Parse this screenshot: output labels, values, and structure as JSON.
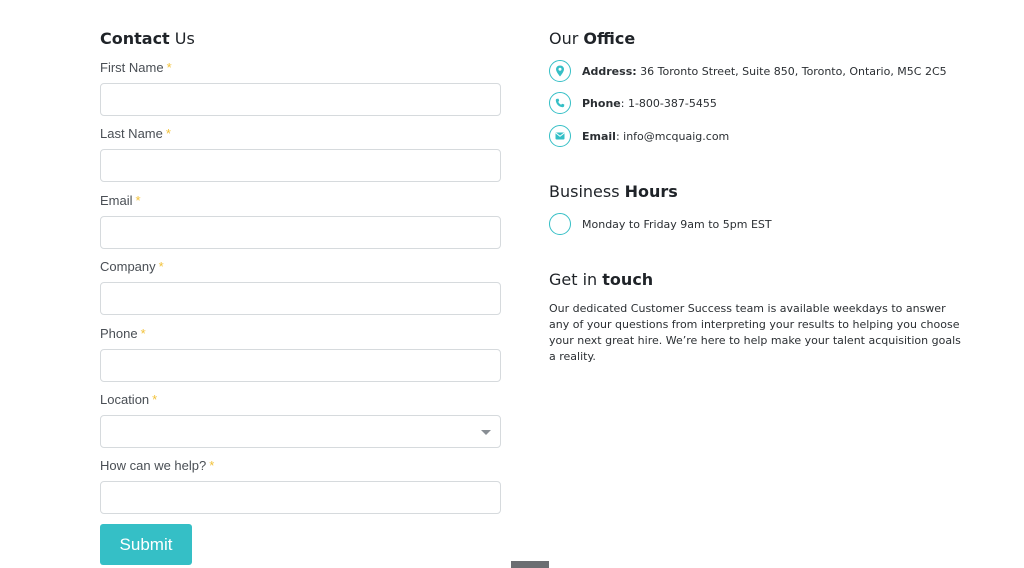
{
  "form": {
    "title_bold": "Contact",
    "title_rest": " Us",
    "required_mark": "*",
    "fields": {
      "first_name": {
        "label": "First Name",
        "value": ""
      },
      "last_name": {
        "label": "Last Name",
        "value": ""
      },
      "email": {
        "label": "Email",
        "value": ""
      },
      "company": {
        "label": "Company",
        "value": ""
      },
      "phone": {
        "label": "Phone",
        "value": ""
      },
      "location": {
        "label": "Location",
        "selected": ""
      },
      "help": {
        "label": "How can we help?",
        "value": ""
      }
    },
    "submit_label": "Submit"
  },
  "office": {
    "title_prefix": "Our ",
    "title_bold": "Office",
    "address_label": "Address:",
    "address_value": " 36 Toronto Street, Suite 850, Toronto, Ontario, M5C 2C5",
    "phone_label": "Phone",
    "phone_value": ": 1-800-387-5455",
    "email_label": "Email",
    "email_value": ": info@mcquaig.com"
  },
  "hours": {
    "title_prefix": "Business ",
    "title_bold": "Hours",
    "text": "Monday to Friday 9am to 5pm EST"
  },
  "touch": {
    "title_prefix": "Get in ",
    "title_bold": "touch",
    "body": "Our dedicated Customer Success team is available weekdays to answer any of your questions from interpreting your results to helping you choose your next great hire. We’re here to help make your talent acquisition goals a reality."
  },
  "icons": {
    "address": "map-pin-icon",
    "phone": "phone-icon",
    "email": "envelope-icon",
    "hours": "clock-icon"
  },
  "colors": {
    "accent": "#35bfc6",
    "required": "#f2c23a",
    "input_border": "#d6dadd"
  }
}
